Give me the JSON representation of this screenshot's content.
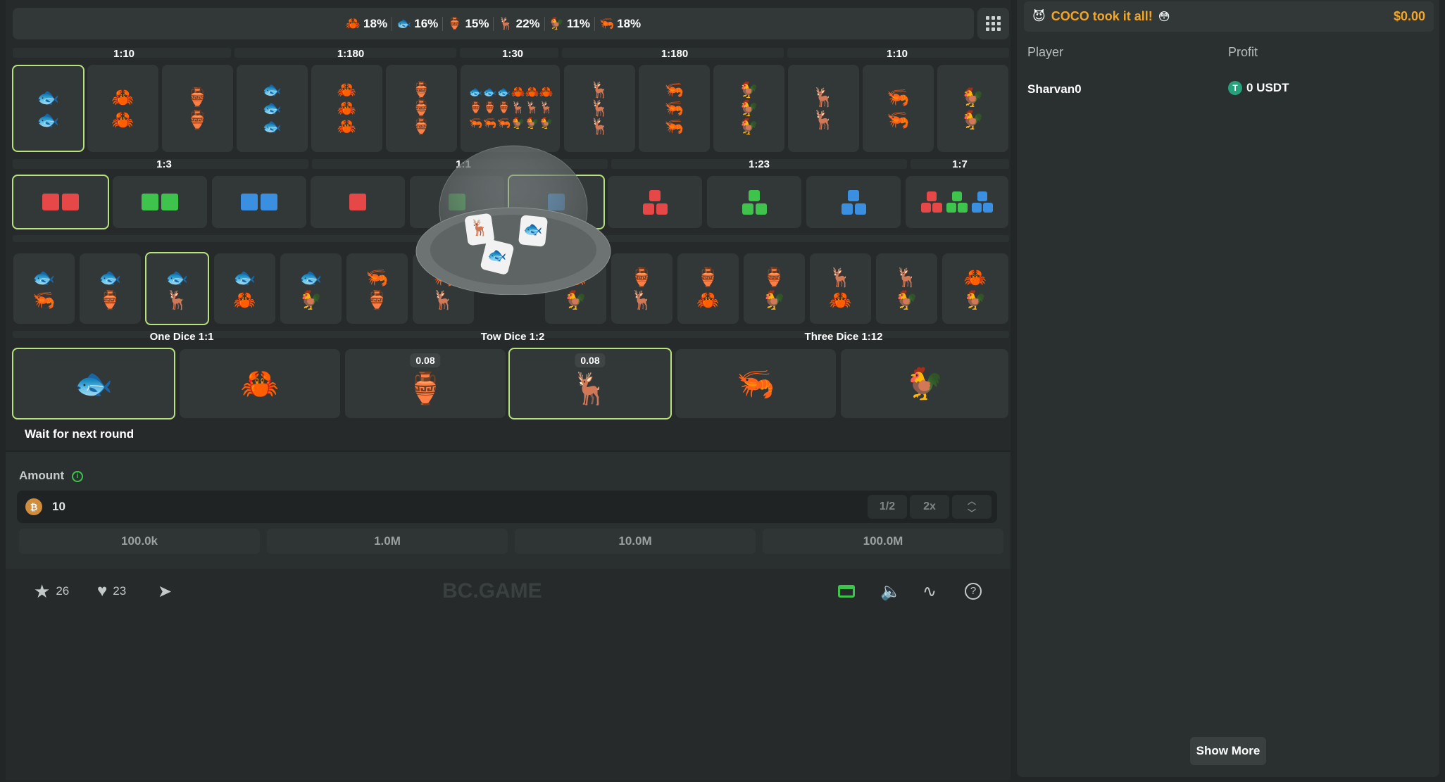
{
  "topbar": {
    "odds": [
      {
        "symbol": "crab",
        "color": "#3ec44c",
        "glyph": "🦀",
        "value": "18%"
      },
      {
        "symbol": "fish",
        "color": "#e64747",
        "glyph": "🐟",
        "value": "16%"
      },
      {
        "symbol": "gourd",
        "color": "#3a8fe0",
        "glyph": "🏺",
        "value": "15%"
      },
      {
        "symbol": "deer",
        "color": "#3a8fe0",
        "glyph": "🦌",
        "value": "22%"
      },
      {
        "symbol": "rooster",
        "color": "#e64747",
        "glyph": "🐓",
        "value": "11%"
      },
      {
        "symbol": "shrimp",
        "color": "#3ec44c",
        "glyph": "🦐",
        "value": "18%"
      }
    ]
  },
  "sections": {
    "row1": [
      "1:10",
      "1:180",
      "1:30",
      "1:180",
      "1:10"
    ],
    "row2": [
      "1:3",
      "1:1",
      "1:23",
      "1:7"
    ],
    "singles": [
      "One Dice 1:1",
      "Tow Dice 1:2",
      "Three Dice 1:12"
    ]
  },
  "singles": [
    {
      "name": "fish",
      "chip": ""
    },
    {
      "name": "crab",
      "chip": ""
    },
    {
      "name": "gourd",
      "chip": "0.08"
    },
    {
      "name": "deer",
      "chip": "0.08"
    },
    {
      "name": "shrimp",
      "chip": ""
    },
    {
      "name": "rooster",
      "chip": ""
    }
  ],
  "status": "Wait for next round",
  "bet": {
    "amount_label": "Amount",
    "amount": "10",
    "half": "1/2",
    "double": "2x",
    "quick": [
      "100.0k",
      "1.0M",
      "10.0M",
      "100.0M"
    ]
  },
  "footer": {
    "favorites": "26",
    "likes": "23",
    "brand": "BC.GAME"
  },
  "side": {
    "winner": "COCO took it all!",
    "winner_amount": "$0.00",
    "col_player": "Player",
    "col_profit": "Profit",
    "player": "Sharvan0",
    "profit": "0 USDT",
    "show_more": "Show More"
  },
  "colors": {
    "accent": "#b7e27d",
    "red": "#e64747",
    "green": "#3ec44c",
    "blue": "#3a8fe0",
    "gold": "#f5a623"
  }
}
